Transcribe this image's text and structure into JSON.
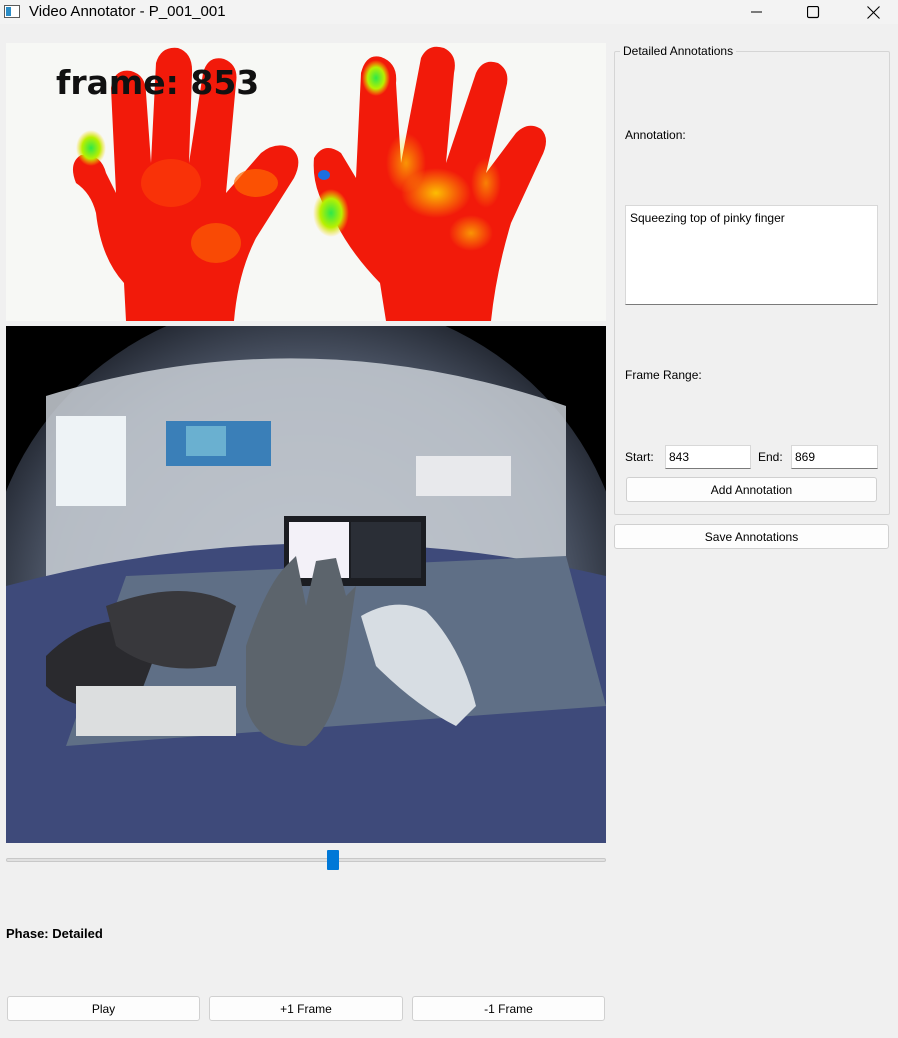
{
  "window": {
    "title": "Video Annotator - P_001_001",
    "minimize_icon": "minimize-icon",
    "maximize_icon": "maximize-icon",
    "close_icon": "close-icon"
  },
  "video": {
    "frame_overlay": "frame: 853",
    "slider_position": 0.545
  },
  "phase_label": "Phase: Detailed",
  "controls": {
    "play_label": "Play",
    "next_frame_label": "+1 Frame",
    "prev_frame_label": "-1 Frame"
  },
  "annotations_panel": {
    "group_title": "Detailed Annotations",
    "annotation_label": "Annotation:",
    "annotation_text": "Squeezing top of pinky finger",
    "frame_range_label": "Frame Range:",
    "start_label": "Start:",
    "start_value": "843",
    "end_label": "End:",
    "end_value": "869",
    "add_button_label": "Add Annotation"
  },
  "save_button_label": "Save Annotations",
  "colors": {
    "slider_accent": "#0078d7",
    "heatmap_base": "#f21a0a",
    "heatmap_hot": "#ffd400",
    "heatmap_green": "#2ee84a"
  }
}
